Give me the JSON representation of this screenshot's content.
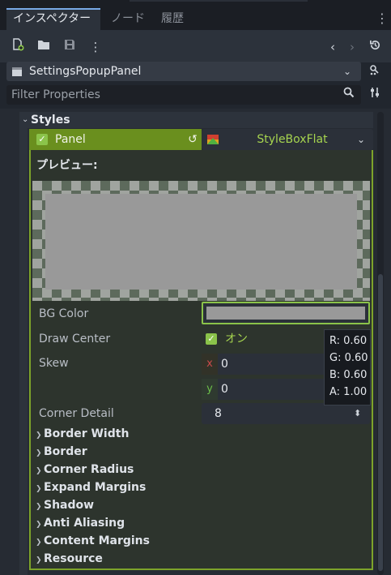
{
  "tabs": [
    {
      "label": "インスペクター",
      "active": true
    },
    {
      "label": "ノード",
      "active": false
    },
    {
      "label": "履歴",
      "active": false
    }
  ],
  "toolbar": {
    "icons": [
      "new-resource-icon",
      "open-folder-icon",
      "save-icon",
      "kebab-menu-icon",
      "back-arrow-icon",
      "forward-arrow-icon",
      "history-icon"
    ]
  },
  "object": {
    "name": "SettingsPopupPanel",
    "icon": "node-panel-icon"
  },
  "filter": {
    "placeholder": "Filter Properties"
  },
  "section": {
    "label": "Styles"
  },
  "panel": {
    "label": "Panel",
    "checked": true,
    "resource_type": "StyleBoxFlat",
    "preview_title": "プレビュー:"
  },
  "props": {
    "bg_color": {
      "label": "BG Color",
      "value": "#999999"
    },
    "draw_center": {
      "label": "Draw Center",
      "value": "オン"
    },
    "skew": {
      "label": "Skew",
      "x_axis": "x",
      "x_value": "0",
      "y_axis": "y",
      "y_value": "0"
    },
    "corner_detail": {
      "label": "Corner Detail",
      "value": "8"
    }
  },
  "tooltip": {
    "r": "R: 0.60",
    "g": "G: 0.60",
    "b": "B: 0.60",
    "a": "A: 1.00"
  },
  "subsections": [
    "Border Width",
    "Border",
    "Corner Radius",
    "Expand Margins",
    "Shadow",
    "Anti Aliasing",
    "Content Margins",
    "Resource"
  ],
  "colors": {
    "accent": "#78a9e6",
    "panel_highlight": "#6a8f1e",
    "check_green": "#8bc34a",
    "value_green": "#a6d44f"
  }
}
